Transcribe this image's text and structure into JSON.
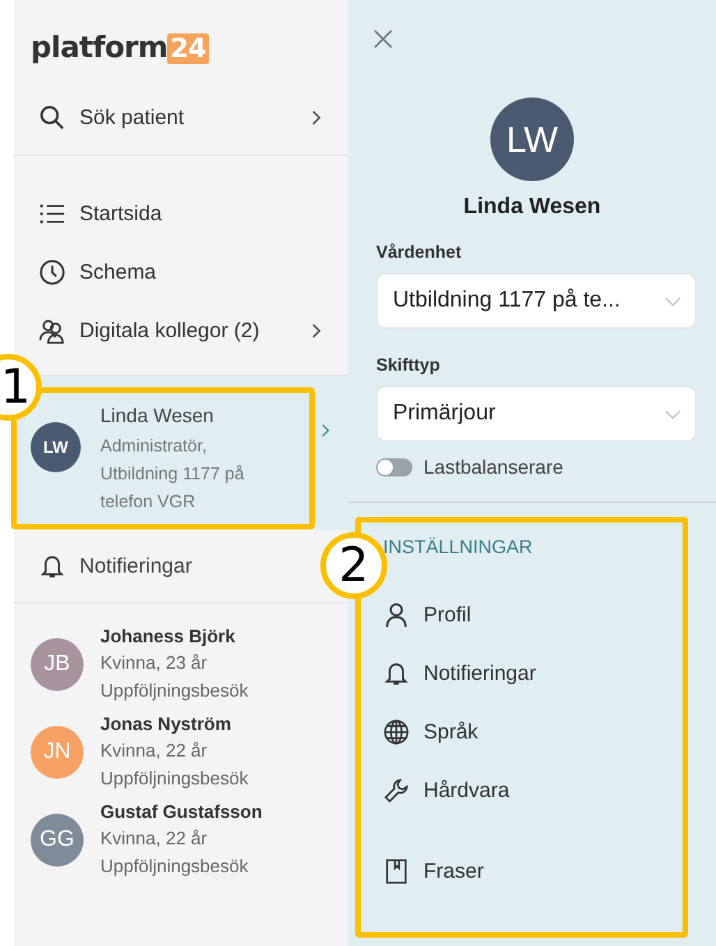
{
  "logo": {
    "text": "platform",
    "badge": "24"
  },
  "search": {
    "label": "Sök patient",
    "arrow": true
  },
  "nav": [
    {
      "label": "Startsida",
      "arrow": false
    },
    {
      "label": "Schema",
      "arrow": false
    },
    {
      "label": "Digitala kollegor (2)",
      "arrow": true
    }
  ],
  "user_card": {
    "initials": "LW",
    "name": "Linda Wesen",
    "role": "Administratör, Utbildning 1177 på telefon VGR",
    "selected": true
  },
  "notifications": {
    "label": "Notifieringar"
  },
  "patients": [
    {
      "initials": "JB",
      "name": "Johaness Björk",
      "info": "Kvinna, 23 år",
      "visit": "Uppföljningsbesök",
      "color": "#a8939f"
    },
    {
      "initials": "JN",
      "name": "Jonas Nyström",
      "info": "Kvinna, 22 år",
      "visit": "Uppföljningsbesök",
      "color": "#f7a264"
    },
    {
      "initials": "GG",
      "name": "Gustaf Gustafsson",
      "info": "Kvinna, 22 år",
      "visit": "Uppföljningsbesök",
      "color": "#7f8b99"
    }
  ],
  "profile": {
    "initials": "LW",
    "name": "Linda Wesen"
  },
  "fields": [
    {
      "label": "Vårdenhet",
      "value": "Utbildning 1177 på te..."
    },
    {
      "label": "Skifttyp",
      "value": "Primärjour"
    }
  ],
  "toggle": {
    "label": "Lastbalanserare",
    "on": false
  },
  "settings": {
    "heading": "INSTÄLLNINGAR",
    "items": [
      {
        "label": "Profil"
      },
      {
        "label": "Notifieringar"
      },
      {
        "label": "Språk"
      },
      {
        "label": "Hårdvara"
      },
      {
        "label": "Fraser"
      }
    ]
  },
  "callouts": [
    {
      "number": "1"
    },
    {
      "number": "2"
    }
  ]
}
